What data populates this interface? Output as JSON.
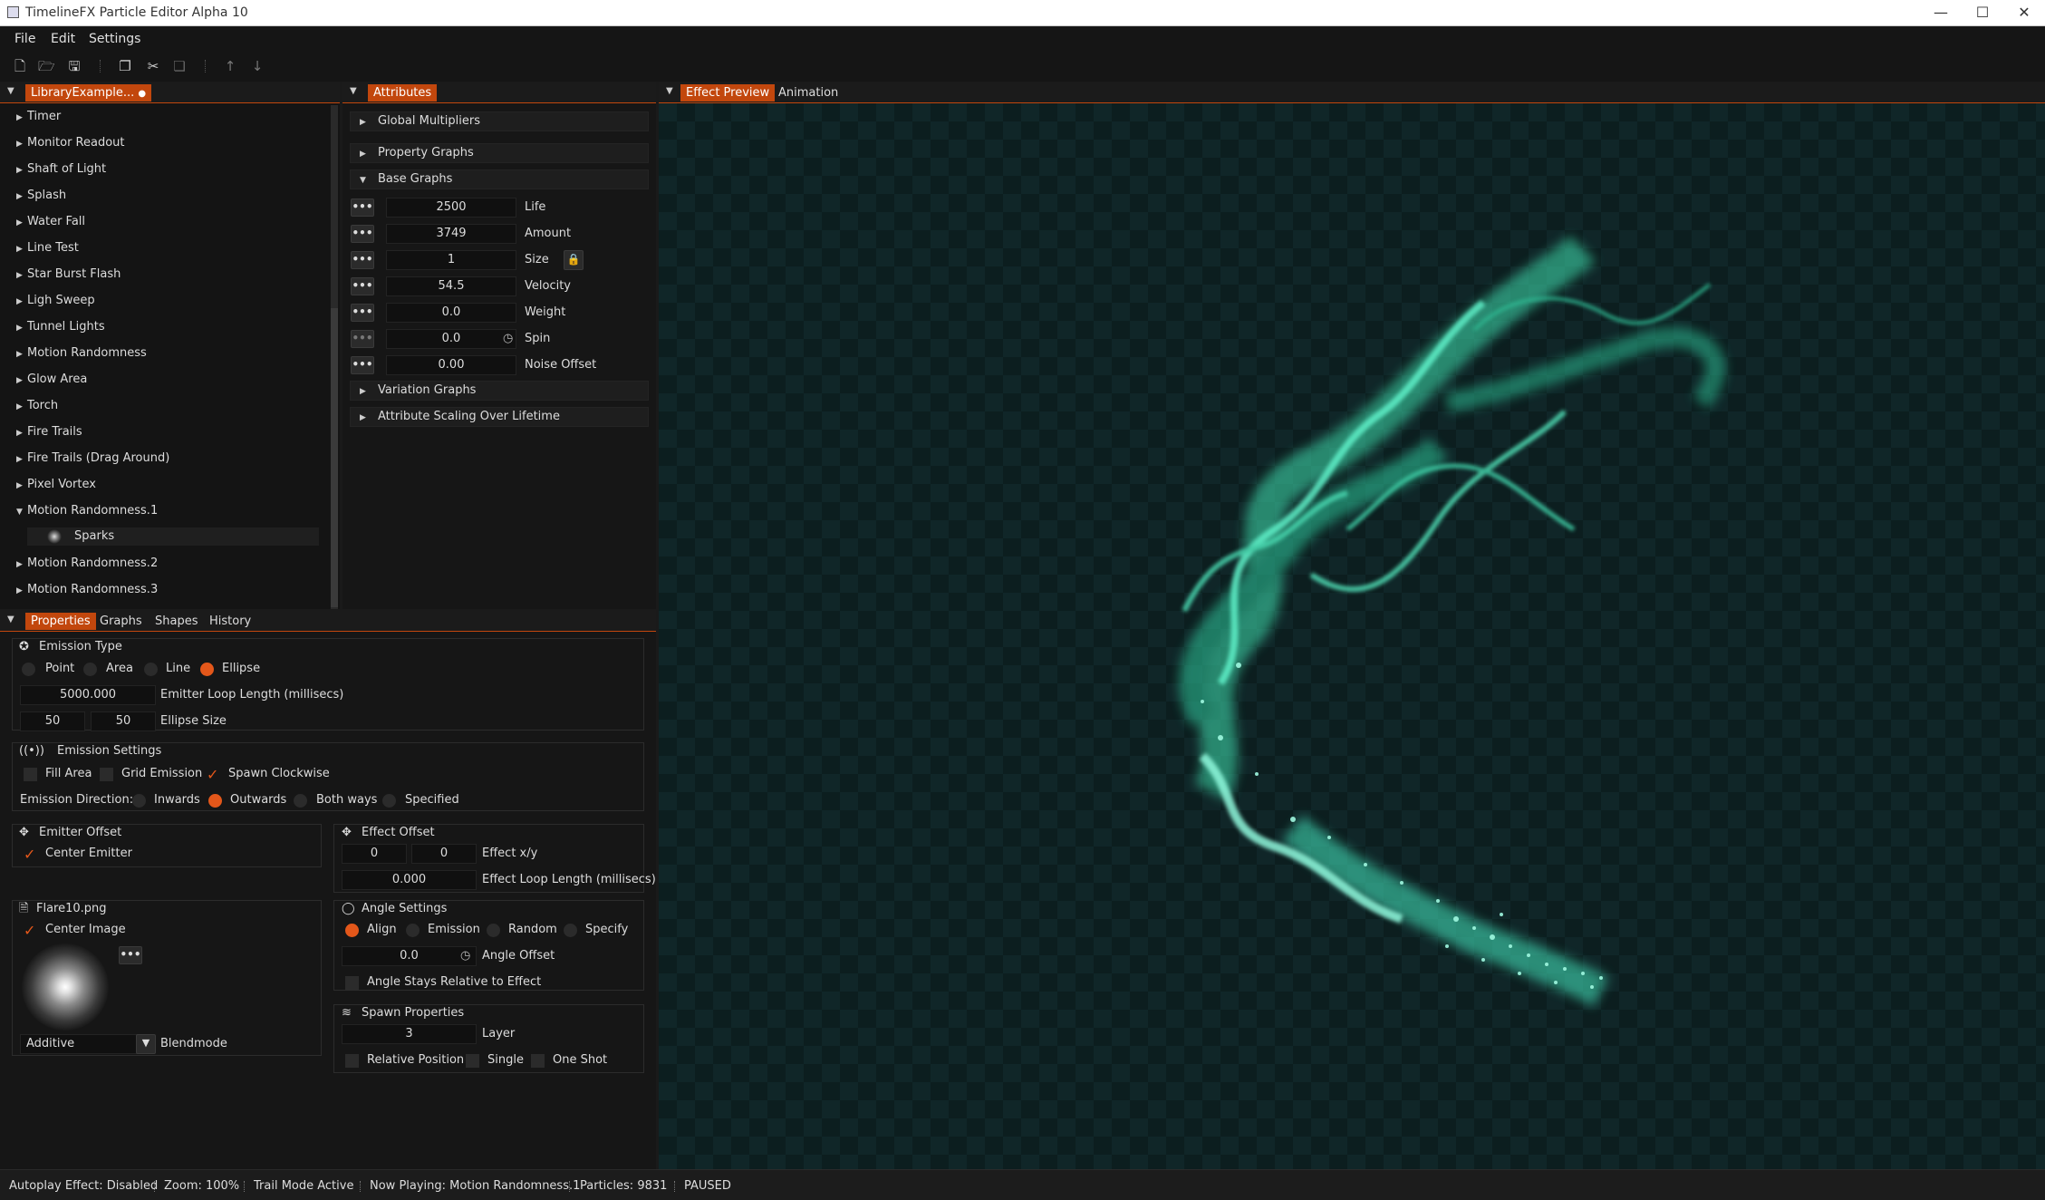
{
  "window": {
    "title": "TimelineFX Particle Editor Alpha 10"
  },
  "menu": [
    "File",
    "Edit",
    "Settings"
  ],
  "library": {
    "tab": "LibraryExample...",
    "items": [
      {
        "label": "Timer"
      },
      {
        "label": "Monitor Readout"
      },
      {
        "label": "Shaft of Light"
      },
      {
        "label": "Splash"
      },
      {
        "label": "Water Fall"
      },
      {
        "label": "Line Test"
      },
      {
        "label": "Star Burst Flash"
      },
      {
        "label": "Ligh Sweep"
      },
      {
        "label": "Tunnel Lights"
      },
      {
        "label": "Motion Randomness"
      },
      {
        "label": "Glow Area"
      },
      {
        "label": "Torch"
      },
      {
        "label": "Fire Trails"
      },
      {
        "label": "Fire Trails (Drag Around)"
      },
      {
        "label": "Pixel Vortex"
      },
      {
        "label": "Motion Randomness.1"
      },
      {
        "label": "Sparks"
      },
      {
        "label": "Motion Randomness.2"
      },
      {
        "label": "Motion Randomness.3"
      }
    ]
  },
  "attributes": {
    "tab": "Attributes",
    "sections": {
      "global": "Global Multipliers",
      "property": "Property Graphs",
      "base": "Base Graphs",
      "variation": "Variation Graphs",
      "scaling": "Attribute Scaling Over Lifetime"
    },
    "rows": [
      {
        "value": "2500",
        "label": "Life"
      },
      {
        "value": "3749",
        "label": "Amount"
      },
      {
        "value": "1",
        "label": "Size"
      },
      {
        "value": "54.5",
        "label": "Velocity"
      },
      {
        "value": "0.0",
        "label": "Weight"
      },
      {
        "value": "0.0",
        "label": "Spin"
      },
      {
        "value": "0.00",
        "label": "Noise Offset"
      }
    ]
  },
  "preview_tabs": [
    "Effect Preview",
    "Animation"
  ],
  "props_tabs": [
    "Properties",
    "Graphs",
    "Shapes",
    "History"
  ],
  "emission_type": {
    "title": "Emission Type",
    "options": [
      "Point",
      "Area",
      "Line",
      "Ellipse"
    ],
    "loop_value": "5000.000",
    "loop_label": "Emitter Loop Length (millisecs)",
    "size_w": "50",
    "size_h": "50",
    "size_label": "Ellipse Size"
  },
  "emission_settings": {
    "title": "Emission Settings",
    "fill_area": "Fill Area",
    "grid": "Grid Emission",
    "spawn_cw": "Spawn Clockwise",
    "direction_label": "Emission Direction:",
    "directions": [
      "Inwards",
      "Outwards",
      "Both ways",
      "Specified"
    ]
  },
  "emitter_offset": {
    "title": "Emitter Offset",
    "center": "Center Emitter"
  },
  "effect_offset": {
    "title": "Effect Offset",
    "x": "0",
    "y": "0",
    "xy_label": "Effect x/y",
    "loop": "0.000",
    "loop_label": "Effect Loop Length (millisecs)"
  },
  "image": {
    "title": "Flare10.png",
    "center": "Center Image",
    "blend": "Additive",
    "blend_label": "Blendmode"
  },
  "angle": {
    "title": "Angle Settings",
    "options": [
      "Align",
      "Emission",
      "Random",
      "Specify"
    ],
    "offset": "0.0",
    "offset_label": "Angle Offset",
    "relative": "Angle Stays Relative to Effect"
  },
  "spawn": {
    "title": "Spawn Properties",
    "layer": "3",
    "layer_label": "Layer",
    "relative": "Relative Position",
    "single": "Single",
    "oneshot": "One Shot"
  },
  "status": [
    "Autoplay Effect: Disabled",
    "Zoom: 100%",
    "Trail Mode Active",
    "Now Playing: Motion Randomness.1",
    "Particles: 9831",
    "PAUSED"
  ],
  "colors": {
    "accent": "#c2470d",
    "particle": "#3fe0b0"
  }
}
